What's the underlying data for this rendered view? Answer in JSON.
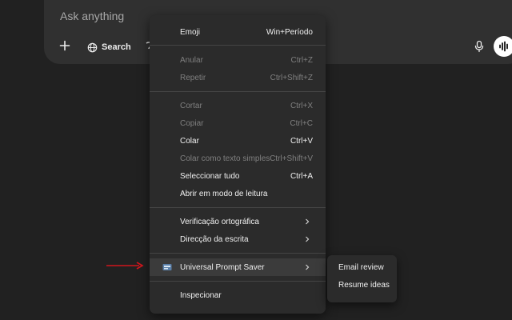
{
  "composer": {
    "placeholder": "Ask anything",
    "search_label": "Search"
  },
  "context_menu": {
    "items": [
      {
        "label": "Emoji",
        "shortcut": "Win+Período"
      },
      {
        "label": "Anular",
        "shortcut": "Ctrl+Z"
      },
      {
        "label": "Repetir",
        "shortcut": "Ctrl+Shift+Z"
      },
      {
        "label": "Cortar",
        "shortcut": "Ctrl+X"
      },
      {
        "label": "Copiar",
        "shortcut": "Ctrl+C"
      },
      {
        "label": "Colar",
        "shortcut": "Ctrl+V"
      },
      {
        "label": "Colar como texto simples",
        "shortcut": "Ctrl+Shift+V"
      },
      {
        "label": "Seleccionar tudo",
        "shortcut": "Ctrl+A"
      },
      {
        "label": "Abrir em modo de leitura",
        "shortcut": ""
      },
      {
        "label": "Verificação ortográfica",
        "shortcut": ""
      },
      {
        "label": "Direcção da escrita",
        "shortcut": ""
      },
      {
        "label": "Universal Prompt Saver",
        "shortcut": ""
      },
      {
        "label": "Inspecionar",
        "shortcut": ""
      }
    ]
  },
  "submenu": {
    "items": [
      "Email review",
      "Resume ideas"
    ]
  },
  "colors": {
    "background": "#212121",
    "composer": "#303030",
    "menu": "#2b2b2b",
    "arrow": "#d0151c"
  }
}
